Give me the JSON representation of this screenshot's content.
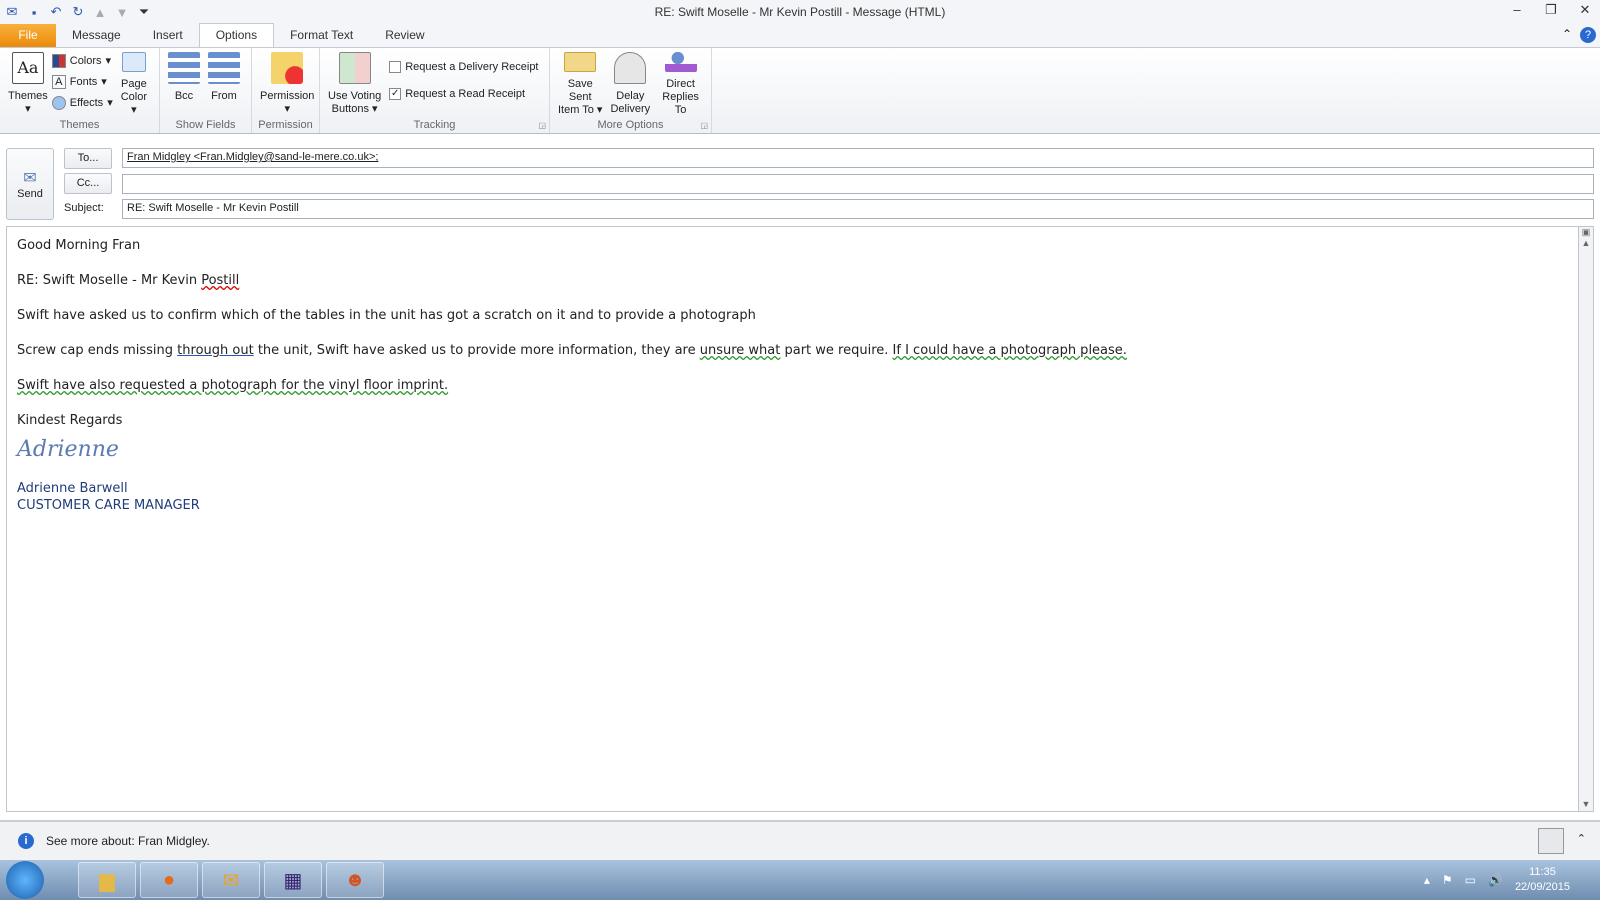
{
  "window": {
    "title": "RE: Swift Moselle  - Mr Kevin Postill  -  Message (HTML)"
  },
  "tabs": [
    "File",
    "Message",
    "Insert",
    "Options",
    "Format Text",
    "Review"
  ],
  "ribbon": {
    "themes": {
      "themes": "Themes",
      "colors": "Colors",
      "fonts": "Fonts",
      "effects": "Effects",
      "page_color_1": "Page",
      "page_color_2": "Color",
      "label": "Themes"
    },
    "show_fields": {
      "bcc": "Bcc",
      "from": "From",
      "label": "Show Fields"
    },
    "permission": {
      "button": "Permission",
      "label": "Permission"
    },
    "tracking": {
      "voting_1": "Use Voting",
      "voting_2": "Buttons",
      "delivery": "Request a Delivery Receipt",
      "delivery_checked": false,
      "read": "Request a Read Receipt",
      "read_checked": true,
      "label": "Tracking"
    },
    "more": {
      "save_1": "Save Sent",
      "save_2": "Item To",
      "delay_1": "Delay",
      "delay_2": "Delivery",
      "direct_1": "Direct",
      "direct_2": "Replies To",
      "label": "More Options"
    }
  },
  "header": {
    "send": "Send",
    "to_button": "To...",
    "cc_button": "Cc...",
    "subject_label": "Subject:",
    "to_value": "Fran Midgley  <Fran.Midgley@sand-le-mere.co.uk>;",
    "cc_value": "",
    "subject_value": "RE: Swift Moselle - Mr Kevin Postill"
  },
  "body": {
    "greeting": "Good Morning Fran",
    "re_prefix": "RE: Swift Moselle - Mr Kevin ",
    "re_name": "Postill",
    "p1": "Swift have asked us to confirm which of the tables in the unit has got a scratch on it and to provide a photograph",
    "p2a": "Screw cap ends missing ",
    "p2b": "through out",
    "p2c": " the unit, Swift have asked us to provide more information, they are ",
    "p2d": "unsure  what",
    "p2e": " part we require.  ",
    "p2f": "If I could have a photograph please.",
    "p3": "Swift have also requested a photograph for the vinyl floor imprint.",
    "closing": "Kindest Regards",
    "signature": "Adrienne",
    "name": "Adrienne Barwell",
    "role": "CUSTOMER CARE MANAGER"
  },
  "people_pane": {
    "text": "See more about: Fran Midgley."
  },
  "taskbar": {
    "time": "11:35",
    "date": "22/09/2015"
  }
}
